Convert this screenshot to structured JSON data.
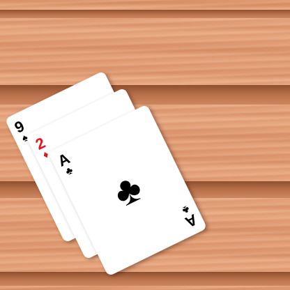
{
  "scene": {
    "table_color": "#e4a27a",
    "ink_black": "#000000",
    "ink_red": "#e4151d"
  },
  "hand": {
    "cards": [
      {
        "rank": "9",
        "suit": "♠",
        "suit_name": "spades",
        "color": "black"
      },
      {
        "rank": "2",
        "suit": "♦",
        "suit_name": "diamonds",
        "color": "red"
      },
      {
        "rank": "A",
        "suit": "♣",
        "suit_name": "clubs",
        "color": "black"
      }
    ]
  }
}
